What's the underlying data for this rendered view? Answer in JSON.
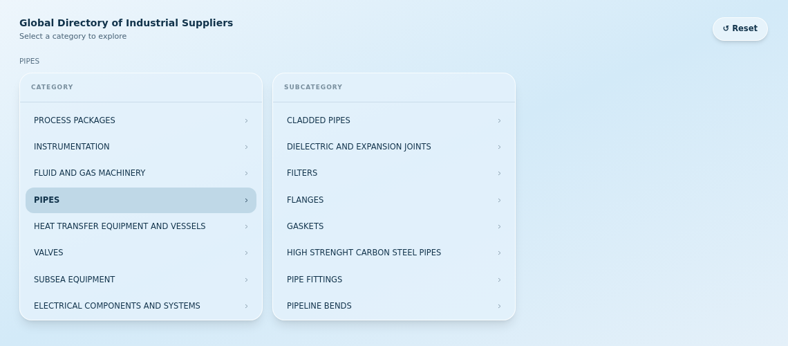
{
  "header": {
    "title": "Global Directory of Industrial Suppliers",
    "subtitle": "Select a category to explore"
  },
  "reset_button": {
    "label": "↺ Reset"
  },
  "breadcrumb": "PIPES",
  "panels": [
    {
      "heading": "CATEGORY",
      "items": [
        {
          "label": "PROCESS PACKAGES",
          "selected": false
        },
        {
          "label": "INSTRUMENTATION",
          "selected": false
        },
        {
          "label": "FLUID AND GAS MACHINERY",
          "selected": false
        },
        {
          "label": "PIPES",
          "selected": true
        },
        {
          "label": "HEAT TRANSFER EQUIPMENT AND VESSELS",
          "selected": false
        },
        {
          "label": "VALVES",
          "selected": false
        },
        {
          "label": "SUBSEA EQUIPMENT",
          "selected": false
        },
        {
          "label": "ELECTRICAL COMPONENTS AND SYSTEMS",
          "selected": false
        }
      ]
    },
    {
      "heading": "SUBCATEGORY",
      "items": [
        {
          "label": "CLADDED PIPES",
          "selected": false
        },
        {
          "label": "DIELECTRIC AND EXPANSION JOINTS",
          "selected": false
        },
        {
          "label": "FILTERS",
          "selected": false
        },
        {
          "label": "FLANGES",
          "selected": false
        },
        {
          "label": "GASKETS",
          "selected": false
        },
        {
          "label": "HIGH STRENGHT CARBON STEEL PIPES",
          "selected": false
        },
        {
          "label": "PIPE FITTINGS",
          "selected": false
        },
        {
          "label": "PIPELINE BENDS",
          "selected": false
        }
      ]
    }
  ]
}
